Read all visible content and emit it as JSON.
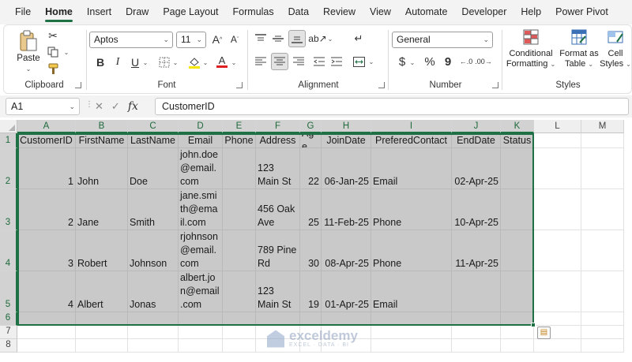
{
  "menu": {
    "tabs": [
      "File",
      "Home",
      "Insert",
      "Draw",
      "Page Layout",
      "Formulas",
      "Data",
      "Review",
      "View",
      "Automate",
      "Developer",
      "Help",
      "Power Pivot"
    ],
    "active": "Home"
  },
  "ribbon": {
    "clipboard": {
      "label": "Clipboard",
      "paste_label": "Paste"
    },
    "font": {
      "label": "Font",
      "font_name": "Aptos",
      "font_size": "11",
      "bold": "B",
      "italic": "I",
      "underline": "U",
      "grow": "A",
      "shrink": "A"
    },
    "alignment": {
      "label": "Alignment"
    },
    "number": {
      "label": "Number",
      "format": "General",
      "currency": "$",
      "percent": "%",
      "comma": "9"
    },
    "styles": {
      "label": "Styles",
      "conditional_line1": "Conditional",
      "conditional_line2": "Formatting",
      "table_line1": "Format as",
      "table_line2": "Table",
      "cell_line1": "Cell",
      "cell_line2": "Styles"
    }
  },
  "formula_bar": {
    "name_box": "A1",
    "fx": "fx",
    "formula": "CustomerID"
  },
  "sheet": {
    "columns": [
      "A",
      "B",
      "C",
      "D",
      "E",
      "F",
      "G",
      "H",
      "I",
      "J",
      "K",
      "L",
      "M"
    ],
    "rows": [
      "1",
      "2",
      "3",
      "4",
      "5",
      "6",
      "7",
      "8"
    ],
    "headers": [
      "CustomerID",
      "FirstName",
      "LastName",
      "Email",
      "Phone",
      "Address",
      "Age",
      "JoinDate",
      "PreferedContact",
      "EndDate",
      "Status"
    ],
    "records": [
      {
        "id": "1",
        "first": "John",
        "last": "Doe",
        "email": "john.doe\n@email.\ncom",
        "phone": "",
        "address": "123\nMain St",
        "age": "22",
        "join": "06-Jan-25",
        "contact": "Email",
        "end": "02-Apr-25",
        "status": ""
      },
      {
        "id": "2",
        "first": "Jane",
        "last": "Smith",
        "email": "jane.smi\nth@ema\nil.com",
        "phone": "",
        "address": "456 Oak\nAve",
        "age": "25",
        "join": "11-Feb-25",
        "contact": "Phone",
        "end": "10-Apr-25",
        "status": ""
      },
      {
        "id": "3",
        "first": "Robert",
        "last": "Johnson",
        "email": "rjohnson\n@email.\ncom",
        "phone": "",
        "address": "789 Pine\nRd",
        "age": "30",
        "join": "08-Apr-25",
        "contact": "Phone",
        "end": "11-Apr-25",
        "status": ""
      },
      {
        "id": "4",
        "first": "Albert",
        "last": "Jonas",
        "email": "albert.jo\nn@email\n.com",
        "phone": "",
        "address": "123\nMain St",
        "age": "19",
        "join": "01-Apr-25",
        "contact": "Email",
        "end": "",
        "status": ""
      }
    ]
  },
  "watermark": {
    "name": "exceldemy",
    "tagline": "EXCEL · DATA · BI"
  }
}
